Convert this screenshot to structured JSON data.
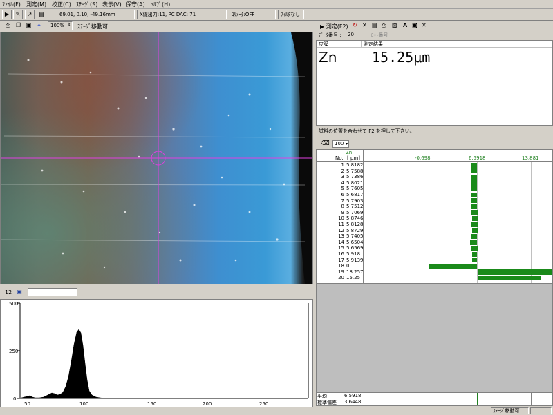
{
  "menu": [
    "ﾌｧｲﾙ(F)",
    "測定(M)",
    "校正(C)",
    "ｽﾃｰｼﾞ(S)",
    "表示(V)",
    "保守(A)",
    "ﾍﾙﾌﾟ(H)"
  ],
  "toolbar": {
    "coords": "69.01,  0.10, -49.16mm",
    "xray": "X線出力:11, PC DAC: 71",
    "collimator": "ｺﾘﾒｰﾀ:OFF",
    "filter": "ﾌｨﾙﾀなし"
  },
  "image_panel": {
    "zoom": "100%",
    "stage_status": "ｽﾃｰｼﾞ移動可"
  },
  "spectrum": {
    "channel": "12",
    "y_ticks": [
      "500",
      "250",
      "0"
    ],
    "x_ticks": [
      "50",
      "100",
      "150",
      "200",
      "250"
    ]
  },
  "measure": {
    "measure_button": "測定(F2)",
    "data_no_label": "ﾃﾞｰﾀ番号 :",
    "data_no": "20",
    "lot_label": "ﾛｯﾄ番号",
    "col_coating": "皮膜",
    "col_result": "測定結果",
    "element": "Zn",
    "value": "15.25μm",
    "message": "試料の位置を合わせて F2 を押して下さい。"
  },
  "stats": {
    "count_select": "100",
    "head_element": "Zn",
    "head_no": "No.",
    "head_unit": "[ μm]",
    "axis_min": "-0.698",
    "axis_mid": "6.5918",
    "axis_max": "13.881",
    "rows": [
      {
        "no": "1",
        "val": "5.8182",
        "v": 5.8182
      },
      {
        "no": "2",
        "val": "5.7588",
        "v": 5.7588
      },
      {
        "no": "3",
        "val": "5.7386",
        "v": 5.7386
      },
      {
        "no": "4",
        "val": "5.8021",
        "v": 5.8021
      },
      {
        "no": "5",
        "val": "5.7605",
        "v": 5.7605
      },
      {
        "no": "6",
        "val": "5.6817",
        "v": 5.6817
      },
      {
        "no": "7",
        "val": "5.7903",
        "v": 5.7903
      },
      {
        "no": "8",
        "val": "5.7512",
        "v": 5.7512
      },
      {
        "no": "9",
        "val": "5.7069",
        "v": 5.7069
      },
      {
        "no": "10",
        "val": "5.8746",
        "v": 5.8746
      },
      {
        "no": "11",
        "val": "5.8128",
        "v": 5.8128
      },
      {
        "no": "12",
        "val": "5.8729",
        "v": 5.8729
      },
      {
        "no": "13",
        "val": "5.7405",
        "v": 5.7405
      },
      {
        "no": "14",
        "val": "5.6504",
        "v": 5.6504
      },
      {
        "no": "15",
        "val": "5.6569",
        "v": 5.6569
      },
      {
        "no": "16",
        "val": "5.918",
        "v": 5.918
      },
      {
        "no": "17",
        "val": "5.9139",
        "v": 5.9139
      },
      {
        "no": "18",
        "val": "0",
        "v": 0
      },
      {
        "no": "19",
        "val": "18.257",
        "v": 18.257
      },
      {
        "no": "20",
        "val": "15.25",
        "v": 15.25
      }
    ],
    "mean_label": "平均",
    "mean": "6.5918",
    "std_label": "標準偏差",
    "std": "3.6448"
  },
  "statusbar": {
    "stage": "ｽﾃｰｼﾞ移動可"
  }
}
